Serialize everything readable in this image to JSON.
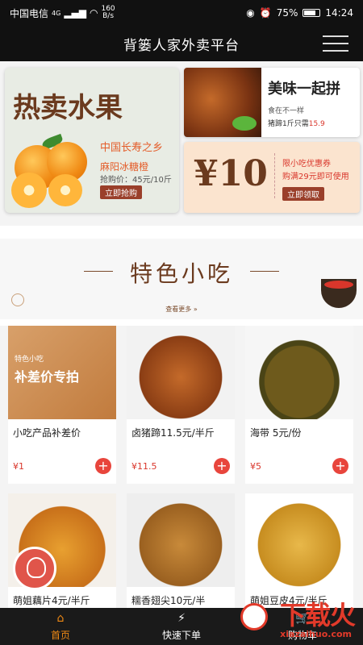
{
  "status_bar": {
    "carrier": "中国电信",
    "network": "4G",
    "speed_value": "160",
    "speed_unit": "B/s",
    "battery": "75%",
    "battery_level": 0.75,
    "time": "14:24"
  },
  "header": {
    "title": "背篓人家外卖平台"
  },
  "promo": {
    "fruit": {
      "title": "热卖水果",
      "slogan": "中国长寿之乡",
      "name": "麻阳冰糖橙",
      "price": "抢购价：45元/10斤",
      "button": "立即抢购"
    },
    "pig": {
      "title": "美味一起拼",
      "subtitle": "食在不一样",
      "price_text": "猪蹄1斤只需",
      "price_value": "15.9"
    },
    "coupon": {
      "value": "¥10",
      "title": "限小吃优惠券",
      "desc": "购满29元即可使用",
      "button": "立即领取"
    }
  },
  "section": {
    "title": "特色小吃",
    "view_more": "查看更多"
  },
  "products": [
    {
      "name": "小吃产品补差价",
      "price": "¥1",
      "image_tag": "特色小吃",
      "image_text": "补差价专拍"
    },
    {
      "name": "卤猪蹄11.5元/半斤",
      "price": "¥11.5"
    },
    {
      "name": "海带 5元/份",
      "price": "¥5"
    },
    {
      "name": "萌姐藕片4元/半斤",
      "price": ""
    },
    {
      "name": "糯香翅尖10元/半",
      "price": ""
    },
    {
      "name": "萌姐豆皮4元/半斤",
      "price": ""
    }
  ],
  "bottom_nav": {
    "items": [
      {
        "label": "首页",
        "icon": "home-icon"
      },
      {
        "label": "快速下单",
        "icon": "lightning-icon"
      },
      {
        "label": "购物车",
        "icon": "cart-icon"
      }
    ]
  },
  "watermark": {
    "text": "下载火",
    "url": "xiazaihuo.com"
  },
  "colors": {
    "header_bg": "#111111",
    "accent_brown": "#6b3a1e",
    "price_red": "#d9362b",
    "active_orange": "#f08a14"
  }
}
